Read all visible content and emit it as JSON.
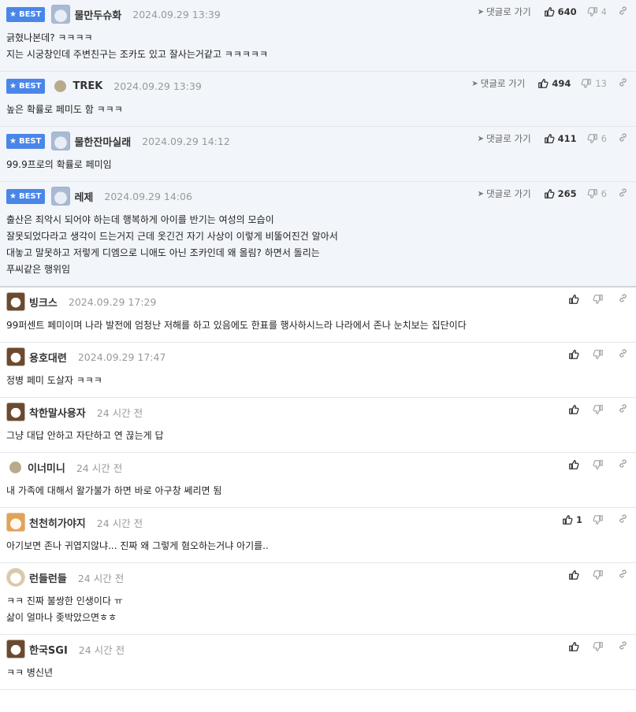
{
  "labels": {
    "best": "BEST",
    "reply": "댓글로 가기"
  },
  "comments": [
    {
      "best": true,
      "avatar": "bear-icon",
      "nickname": "물만두슈화",
      "date": "2024.09.29 13:39",
      "up": "640",
      "down": "4",
      "lines": [
        "긁혔나본데? ㅋㅋㅋㅋ",
        "지는 시궁창인데 주변친구는 조카도 있고 잘사는거같고 ㅋㅋㅋㅋㅋ"
      ]
    },
    {
      "best": true,
      "avatar": "dot-icon",
      "nickname": "TREK",
      "date": "2024.09.29 13:39",
      "up": "494",
      "down": "13",
      "lines": [
        "높은 확률로 페미도 함 ㅋㅋㅋ"
      ]
    },
    {
      "best": true,
      "avatar": "bear-icon",
      "nickname": "물한잔마실래",
      "date": "2024.09.29 14:12",
      "up": "411",
      "down": "6",
      "lines": [
        "99.9프로의 확률로 페미임"
      ]
    },
    {
      "best": true,
      "avatar": "bear-icon",
      "nickname": "레제",
      "date": "2024.09.29 14:06",
      "up": "265",
      "down": "6",
      "lines": [
        "출산은 죄악시 되어야 하는데 행복하게 아이를 반기는 여성의 모습이",
        "잘못되었다라고 생각이 드는거지 근데 옷긴건 자기 사상이 이렇게 비뚤어진건 알아서",
        "대놓고 말못하고 저렇게 디엠으로 니애도 아닌 조카인데 왜 올림? 하면서 돌리는",
        "푸씨같은 행위임"
      ]
    },
    {
      "best": false,
      "avatar": "dog-icon",
      "nickname": "빙크스",
      "date": "2024.09.29 17:29",
      "up": "",
      "down": "",
      "lines": [
        "99퍼센트 페미이며 나라 발전에 엄청난 저해를 하고 있음에도 한표를 행사하시느라 나라에서 존나 눈치보는 집단이다"
      ]
    },
    {
      "best": false,
      "avatar": "dog-icon",
      "nickname": "용호대련",
      "date": "2024.09.29 17:47",
      "up": "",
      "down": "",
      "lines": [
        "정병 페미 도살자 ㅋㅋㅋ"
      ]
    },
    {
      "best": false,
      "avatar": "dog-icon",
      "nickname": "착한말사용자",
      "date": "24 시간 전",
      "up": "",
      "down": "",
      "lines": [
        "그냥 대답 안하고 자단하고 연 끊는게 답"
      ]
    },
    {
      "best": false,
      "avatar": "dot-icon",
      "nickname": "이너미니",
      "date": "24 시간 전",
      "up": "",
      "down": "",
      "lines": [
        "내 가족에 대해서 왈가불가 하면 바로 아구창 쎄리면 됨"
      ]
    },
    {
      "best": false,
      "avatar": "cat-icon",
      "nickname": "천천히가야지",
      "date": "24 시간 전",
      "up": "1",
      "down": "",
      "lines": [
        "아기보면 존나 귀엽지않냐... 진짜 왜 그렇게 혐오하는거냐 아기를.."
      ]
    },
    {
      "best": false,
      "avatar": "puppy-icon",
      "nickname": "런들런들",
      "date": "24 시간 전",
      "up": "",
      "down": "",
      "lines": [
        "ㅋㅋ 진짜 불쌍한 인생이다 ㅠ",
        "삶이 얼마나 좆박았으면ㅎㅎ"
      ]
    },
    {
      "best": false,
      "avatar": "dog-icon",
      "nickname": "한국SGI",
      "date": "24 시간 전",
      "up": "",
      "down": "",
      "lines": [
        "ㅋㅋ 병신년"
      ]
    }
  ]
}
